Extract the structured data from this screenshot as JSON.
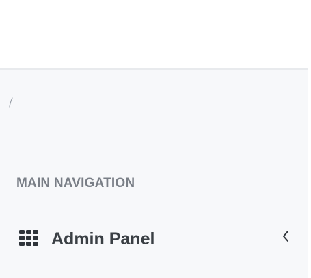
{
  "sidebar": {
    "section_header": "MAIN NAVIGATION",
    "items": [
      {
        "label": "Admin Panel",
        "icon": "th-grid-icon",
        "expand_icon": "chevron-left-icon"
      }
    ]
  },
  "colors": {
    "sidebar_background": "#f7f8fa",
    "topbar_background": "#ffffff",
    "header_text": "#7a7f87",
    "item_text": "#3a3f44",
    "icon": "#2f343a"
  }
}
